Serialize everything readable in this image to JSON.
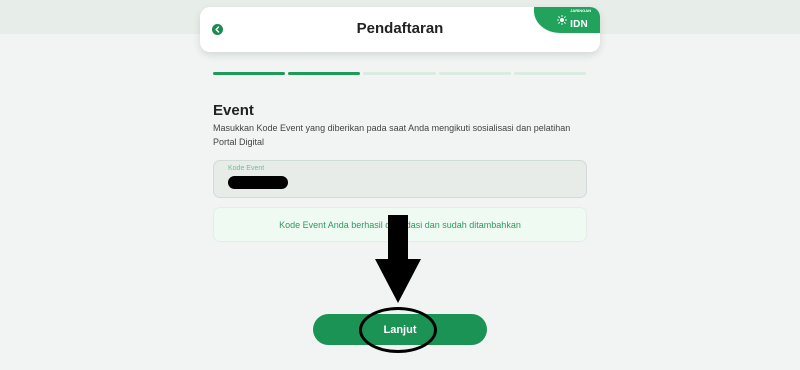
{
  "header": {
    "title": "Pendaftaran",
    "brand_small": "JARINGAN",
    "brand_name": "IDN"
  },
  "progress": {
    "total_steps": 5,
    "completed_steps": 2
  },
  "event": {
    "title": "Event",
    "description": "Masukkan Kode Event yang diberikan pada saat Anda mengikuti sosialisasi dan pelatihan Portal Digital",
    "input_label": "Kode Event",
    "input_value": "",
    "success_message": "Kode Event Anda berhasil divalidasi dan sudah ditambahkan"
  },
  "actions": {
    "next_label": "Lanjut"
  },
  "colors": {
    "primary": "#1b9355",
    "brand": "#21a35c",
    "background": "#f1f4f2",
    "success_text": "#2e9a60"
  },
  "icons": {
    "back": "chevron-left-icon",
    "brand": "sun-icon"
  }
}
